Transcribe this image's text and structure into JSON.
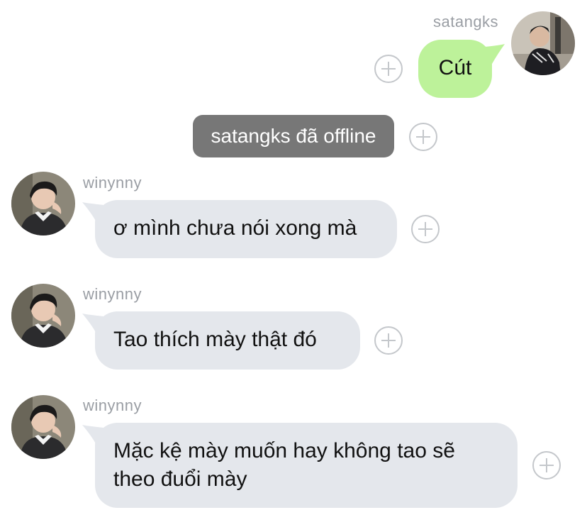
{
  "messages": [
    {
      "sender": "satangks",
      "text": "Cút"
    },
    {
      "system": "satangks đã offline"
    },
    {
      "sender": "winynny",
      "text": "ơ mình chưa nói xong mà"
    },
    {
      "sender": "winynny",
      "text": "Tao thích mày thật đó"
    },
    {
      "sender": "winynny",
      "text": "Mặc kệ mày muốn hay không tao sẽ theo đuổi mày"
    }
  ],
  "icons": {
    "react": "plus-circle-icon",
    "avatar": "user-avatar"
  },
  "colors": {
    "outgoing_bubble": "#bdf29a",
    "incoming_bubble": "#e4e7ec",
    "system_pill": "#777777",
    "name_text": "#9a9ea4"
  }
}
